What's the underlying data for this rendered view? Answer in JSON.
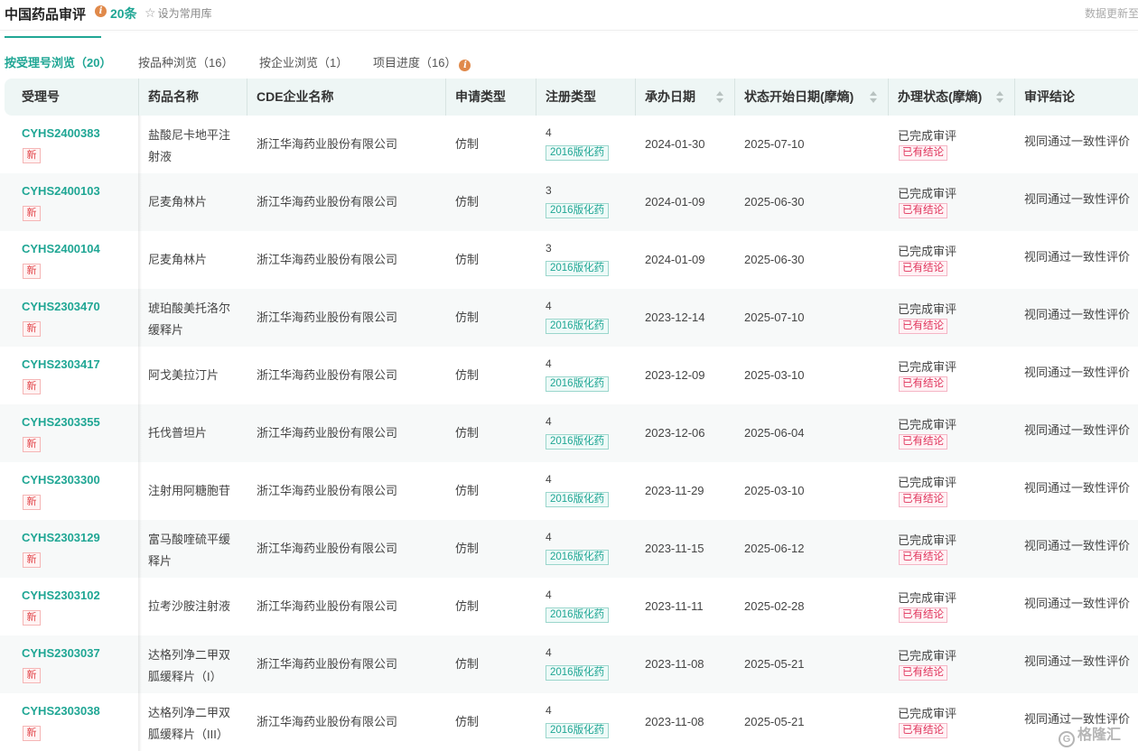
{
  "header": {
    "title": "中国药品审评",
    "count": "20条",
    "favorite_label": "设为常用库",
    "update_text": "数据更新至"
  },
  "tabs": [
    {
      "label": "按受理号浏览（20）",
      "active": true
    },
    {
      "label": "按品种浏览（16）",
      "active": false
    },
    {
      "label": "按企业浏览（1）",
      "active": false
    },
    {
      "label": "项目进度（16）",
      "active": false
    }
  ],
  "columns": {
    "acceptance_no": "受理号",
    "drug_name": "药品名称",
    "company": "CDE企业名称",
    "application_type": "申请类型",
    "registration_type": "注册类型",
    "handling_date": "承办日期",
    "status_start_date": "状态开始日期(摩熵)",
    "handling_status": "办理状态(摩熵)",
    "conclusion": "审评结论"
  },
  "rows": [
    {
      "no": "CYHS2400383",
      "badge": "新",
      "drug": "盐酸尼卡地平注射液",
      "company": "浙江华海药业股份有限公司",
      "app_type": "仿制",
      "reg_num": "4",
      "reg_tag": "2016版化药",
      "date1": "2024-01-30",
      "date2": "2025-07-10",
      "status": "已完成审评",
      "status_tag": "已有结论",
      "result": "视同通过一致性评价"
    },
    {
      "no": "CYHS2400103",
      "badge": "新",
      "drug": "尼麦角林片",
      "company": "浙江华海药业股份有限公司",
      "app_type": "仿制",
      "reg_num": "3",
      "reg_tag": "2016版化药",
      "date1": "2024-01-09",
      "date2": "2025-06-30",
      "status": "已完成审评",
      "status_tag": "已有结论",
      "result": "视同通过一致性评价"
    },
    {
      "no": "CYHS2400104",
      "badge": "新",
      "drug": "尼麦角林片",
      "company": "浙江华海药业股份有限公司",
      "app_type": "仿制",
      "reg_num": "3",
      "reg_tag": "2016版化药",
      "date1": "2024-01-09",
      "date2": "2025-06-30",
      "status": "已完成审评",
      "status_tag": "已有结论",
      "result": "视同通过一致性评价"
    },
    {
      "no": "CYHS2303470",
      "badge": "新",
      "drug": "琥珀酸美托洛尔缓释片",
      "company": "浙江华海药业股份有限公司",
      "app_type": "仿制",
      "reg_num": "4",
      "reg_tag": "2016版化药",
      "date1": "2023-12-14",
      "date2": "2025-07-10",
      "status": "已完成审评",
      "status_tag": "已有结论",
      "result": "视同通过一致性评价"
    },
    {
      "no": "CYHS2303417",
      "badge": "新",
      "drug": "阿戈美拉汀片",
      "company": "浙江华海药业股份有限公司",
      "app_type": "仿制",
      "reg_num": "4",
      "reg_tag": "2016版化药",
      "date1": "2023-12-09",
      "date2": "2025-03-10",
      "status": "已完成审评",
      "status_tag": "已有结论",
      "result": "视同通过一致性评价"
    },
    {
      "no": "CYHS2303355",
      "badge": "新",
      "drug": "托伐普坦片",
      "company": "浙江华海药业股份有限公司",
      "app_type": "仿制",
      "reg_num": "4",
      "reg_tag": "2016版化药",
      "date1": "2023-12-06",
      "date2": "2025-06-04",
      "status": "已完成审评",
      "status_tag": "已有结论",
      "result": "视同通过一致性评价"
    },
    {
      "no": "CYHS2303300",
      "badge": "新",
      "drug": "注射用阿糖胞苷",
      "company": "浙江华海药业股份有限公司",
      "app_type": "仿制",
      "reg_num": "4",
      "reg_tag": "2016版化药",
      "date1": "2023-11-29",
      "date2": "2025-03-10",
      "status": "已完成审评",
      "status_tag": "已有结论",
      "result": "视同通过一致性评价"
    },
    {
      "no": "CYHS2303129",
      "badge": "新",
      "drug": "富马酸喹硫平缓释片",
      "company": "浙江华海药业股份有限公司",
      "app_type": "仿制",
      "reg_num": "4",
      "reg_tag": "2016版化药",
      "date1": "2023-11-15",
      "date2": "2025-06-12",
      "status": "已完成审评",
      "status_tag": "已有结论",
      "result": "视同通过一致性评价"
    },
    {
      "no": "CYHS2303102",
      "badge": "新",
      "drug": "拉考沙胺注射液",
      "company": "浙江华海药业股份有限公司",
      "app_type": "仿制",
      "reg_num": "4",
      "reg_tag": "2016版化药",
      "date1": "2023-11-11",
      "date2": "2025-02-28",
      "status": "已完成审评",
      "status_tag": "已有结论",
      "result": "视同通过一致性评价"
    },
    {
      "no": "CYHS2303037",
      "badge": "新",
      "drug": "达格列净二甲双胍缓释片（I）",
      "company": "浙江华海药业股份有限公司",
      "app_type": "仿制",
      "reg_num": "4",
      "reg_tag": "2016版化药",
      "date1": "2023-11-08",
      "date2": "2025-05-21",
      "status": "已完成审评",
      "status_tag": "已有结论",
      "result": "视同通过一致性评价"
    },
    {
      "no": "CYHS2303038",
      "badge": "新",
      "drug": "达格列净二甲双胍缓释片（III）",
      "company": "浙江华海药业股份有限公司",
      "app_type": "仿制",
      "reg_num": "4",
      "reg_tag": "2016版化药",
      "date1": "2023-11-08",
      "date2": "2025-05-21",
      "status": "已完成审评",
      "status_tag": "已有结论",
      "result": "视同通过一致性评价"
    }
  ],
  "watermark": "格隆汇",
  "colors": {
    "accent": "#1fa694",
    "badge_red": "#e2474c",
    "info_orange": "#e0894a",
    "header_bg": "#eef6f5"
  }
}
